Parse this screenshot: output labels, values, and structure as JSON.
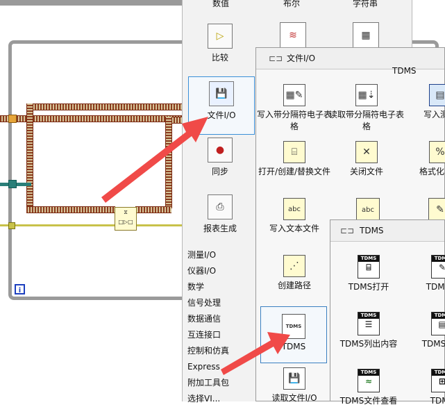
{
  "palette": {
    "top_labels": [
      "数值",
      "布尔",
      "字符串"
    ],
    "items": [
      {
        "label": "比较",
        "icon": "comparison-icon"
      },
      {
        "label": "文件I/O",
        "icon": "file-io-floppy-icon"
      },
      {
        "label": "同步",
        "icon": "synchronization-traffic-light-icon"
      },
      {
        "label": "报表生成",
        "icon": "report-generation-icon"
      }
    ],
    "categories": [
      "测量I/O",
      "仪器I/O",
      "数学",
      "信号处理",
      "数据通信",
      "互连接口",
      "控制和仿真",
      "Express",
      "附加工具包",
      "选择VI..."
    ]
  },
  "file_io": {
    "title": "文件I/O",
    "section": "TDMS",
    "items": [
      {
        "label": "写入带分隔符电子表格",
        "icon": "write-delimited-spreadsheet-icon"
      },
      {
        "label": "读取带分隔符电子表格",
        "icon": "read-delimited-spreadsheet-icon"
      },
      {
        "label": "写入测量",
        "icon": "write-measurement-icon"
      },
      {
        "label": "打开/创建/替换文件",
        "icon": "open-create-replace-file-icon"
      },
      {
        "label": "关闭文件",
        "icon": "close-file-icon"
      },
      {
        "label": "格式化写入",
        "icon": "format-into-file-icon"
      },
      {
        "label": "写入文本文件",
        "icon": "write-text-file-icon"
      },
      {
        "label": "创建路径",
        "icon": "build-path-icon"
      },
      {
        "label": "TDMS",
        "icon": "tdms-folder-icon"
      },
      {
        "label": "读取文件I/O",
        "icon": "file-io-read-icon"
      }
    ]
  },
  "tdms_sub": {
    "title": "TDMS",
    "items": [
      {
        "label": "TDMS打开",
        "icon": "tdms-open-icon"
      },
      {
        "label": "TDMS写",
        "icon": "tdms-write-icon"
      },
      {
        "label": "TDMS列出内容",
        "icon": "tdms-list-contents-icon"
      },
      {
        "label": "TDMS设置",
        "icon": "tdms-set-properties-icon"
      },
      {
        "label": "TDMS文件查看",
        "icon": "tdms-file-viewer-icon"
      },
      {
        "label": "TDMS",
        "icon": "tdms-more-icon"
      }
    ],
    "icon_text": "TDMS"
  },
  "diagram": {
    "info_glyph": "i",
    "node_glyph": "⧖"
  },
  "colors": {
    "arrow": "#f04a48",
    "error_wire": "#8a3b1d",
    "ref_wire": "#2a7f79",
    "loop_border": "#9a9a9a",
    "selection": "#3a8fd8"
  }
}
